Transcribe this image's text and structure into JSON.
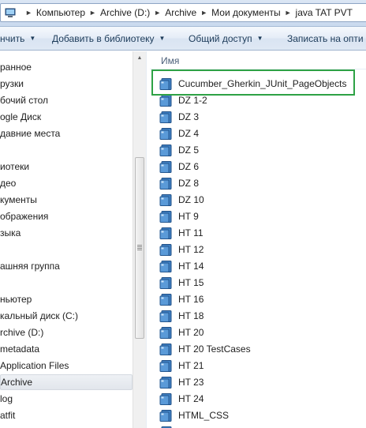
{
  "address_bar": {
    "crumbs": [
      "Компьютер",
      "Archive (D:)",
      "Archive",
      "Мои документы",
      "java TAT PVT"
    ]
  },
  "toolbar": {
    "organize_label": "нчить",
    "add_library_label": "Добавить в библиотеку",
    "share_label": "Общий доступ",
    "burn_label": "Записать на опти"
  },
  "nav": {
    "items": [
      "ранное",
      "рузки",
      "бочий стол",
      "ogle Диск",
      "давние места",
      "",
      "иотеки",
      "део",
      "кументы",
      "ображения",
      "зыка",
      "",
      "ашняя группа",
      "",
      "ньютер",
      "кальный диск (C:)",
      "rchive (D:)",
      "metadata",
      "Application Files",
      "Archive",
      "log",
      "atfit"
    ],
    "selected_index": 19
  },
  "filelist": {
    "column_name": "Имя",
    "items": [
      "Cucumber_Gherkin_JUnit_PageObjects",
      "DZ 1-2",
      "DZ 3",
      "DZ 4",
      "DZ 5",
      "DZ 6",
      "DZ 8",
      "DZ 10",
      "HT 9",
      "HT 11",
      "HT 12",
      "HT 14",
      "HT 15",
      "HT 16",
      "HT 18",
      "HT 20",
      "HT 20 TestCases",
      "HT 21",
      "HT 23",
      "HT 24",
      "HTML_CSS",
      ""
    ],
    "highlighted_index": 0
  },
  "colors": {
    "highlight_border": "#2ea245",
    "folder_blue": "#3f7fc1"
  },
  "icons": {
    "address": "computer-icon",
    "crumb_separator": "chevron-right-icon",
    "toolbar_dropdown": "chevron-down-icon",
    "file": "folder-icon"
  }
}
